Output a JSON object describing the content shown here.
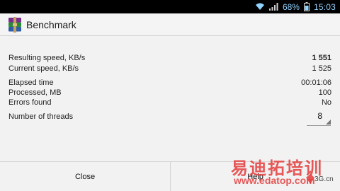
{
  "status_bar": {
    "battery_percent": "68%",
    "time": "15:03",
    "icons": [
      "wifi-icon",
      "signal-icon",
      "battery-icon"
    ]
  },
  "action_bar": {
    "title": "Benchmark",
    "app_icon": "winrar-books-icon"
  },
  "results": {
    "resulting_speed": {
      "label": "Resulting speed, KB/s",
      "value": "1 551"
    },
    "current_speed": {
      "label": "Current speed, KB/s",
      "value": "1 525"
    },
    "elapsed_time": {
      "label": "Elapsed time",
      "value": "00:01:06"
    },
    "processed": {
      "label": "Processed, MB",
      "value": "100"
    },
    "errors_found": {
      "label": "Errors found",
      "value": "No"
    },
    "threads": {
      "label": "Number of threads",
      "value": "8"
    }
  },
  "buttons": {
    "close": "Close",
    "help": "Help"
  },
  "watermark": {
    "chinese": "易迪拓培训",
    "url": "www.edatop.com",
    "brand": "3G.cn"
  },
  "colors": {
    "status_bar_bg": "#000000",
    "time_color": "#8fd3ff",
    "background": "#f2f2f2",
    "watermark_red": "#e43c3c"
  }
}
